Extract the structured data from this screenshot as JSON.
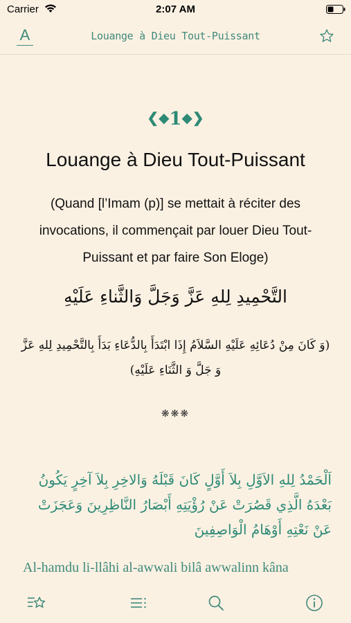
{
  "status_bar": {
    "carrier": "Carrier",
    "time": "2:07 AM"
  },
  "nav": {
    "font_button": "A",
    "title": "Louange à Dieu Tout-Puissant",
    "icons": [
      "font-size-icon",
      "star-icon"
    ]
  },
  "content": {
    "chapter_number": "1",
    "chapter_title": "Louange à Dieu Tout-Puissant",
    "intro_fr": "(Quand [l’Imam (p)] se mettait à réciter des invocations, il commençait par louer Dieu Tout-Puissant et par faire Son Eloge)",
    "arabic_heading": "التَّحْمِيدِ لِلهِ عَزَّ وَجَلَّ وَالثَّناءِ عَلَيْهِ",
    "arabic_intro": "(وَ كَانَ مِنْ دُعَائِهِ عَلَيْهِ السَّلاَمُ إِذَا ابْتَدَأَ بِالدُّعَاءِ بَدَأَ بِالتَّحْمِيدِ لِلهِ عَزَّ وَ جَلَّ وَ الثَّنَاءِ عَلَيْهِ)",
    "separator": "❋❋❋",
    "arabic_prayer": "اَلْحَمْدُ لِلهِ الاَوَّلِ بِلاَ أَوَّلٍ كَانَ قَبْلَهُ وَالاخِرِ بِلاَ آخِرٍ يَكُونُ بَعْدَهُ الَّذِي قَصُرَتْ عَنْ رُؤْيَتِهِ أَبْصَارُ النَّاظِرِينَ وَعَجَزَتْ عَنْ نَعْتِهِ أَوْهَامُ الْوَاصِفِينَ",
    "transliteration": "Al-hamdu li-llâhi al-awwali bilâ awwalinn kâna"
  },
  "tab_bar": {
    "icons": [
      "favorites-list-icon",
      "table-of-contents-icon",
      "search-icon",
      "info-icon"
    ]
  },
  "colors": {
    "accent": "#3f8a7a",
    "background": "#fbf1e3"
  }
}
